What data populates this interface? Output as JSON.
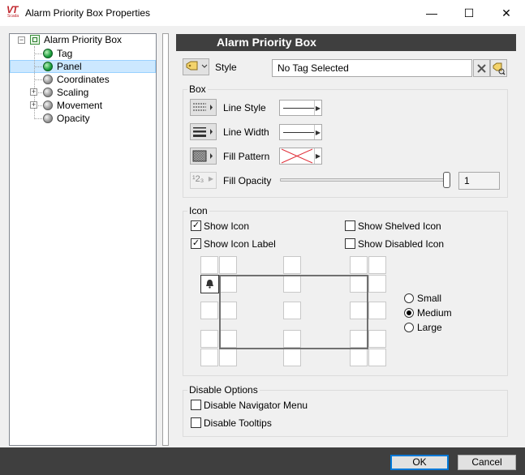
{
  "window": {
    "title": "Alarm Priority Box Properties",
    "logo_text": "VT",
    "logo_sub": "Scada",
    "minimize": "—",
    "maximize": "☐",
    "close": "✕"
  },
  "tree": {
    "root": "Alarm Priority Box",
    "items": [
      {
        "label": "Tag"
      },
      {
        "label": "Panel"
      },
      {
        "label": "Coordinates"
      },
      {
        "label": "Scaling"
      },
      {
        "label": "Movement"
      },
      {
        "label": "Opacity"
      }
    ],
    "selected": "Panel"
  },
  "header": {
    "title": "Alarm Priority Box"
  },
  "style": {
    "label": "Style",
    "value": "No Tag Selected"
  },
  "box": {
    "title": "Box",
    "line_style": "Line Style",
    "line_width": "Line Width",
    "fill_pattern": "Fill Pattern",
    "fill_opacity": "Fill Opacity",
    "fill_opacity_value": "1",
    "fill_opacity_level": 1.0,
    "opacity_icon": "¹2₃"
  },
  "icon": {
    "title": "Icon",
    "show_icon": "Show Icon",
    "show_icon_checked": true,
    "show_icon_label": "Show Icon Label",
    "show_icon_label_checked": true,
    "show_shelved_icon": "Show Shelved Icon",
    "show_shelved_icon_checked": false,
    "show_disabled_icon": "Show Disabled Icon",
    "show_disabled_icon_checked": false,
    "sizes": [
      "Small",
      "Medium",
      "Large"
    ],
    "selected_size": "Medium"
  },
  "disable": {
    "title": "Disable Options",
    "navigator_menu": "Disable Navigator Menu",
    "tooltips": "Disable Tooltips"
  },
  "buttons": {
    "ok": "OK",
    "cancel": "Cancel"
  }
}
